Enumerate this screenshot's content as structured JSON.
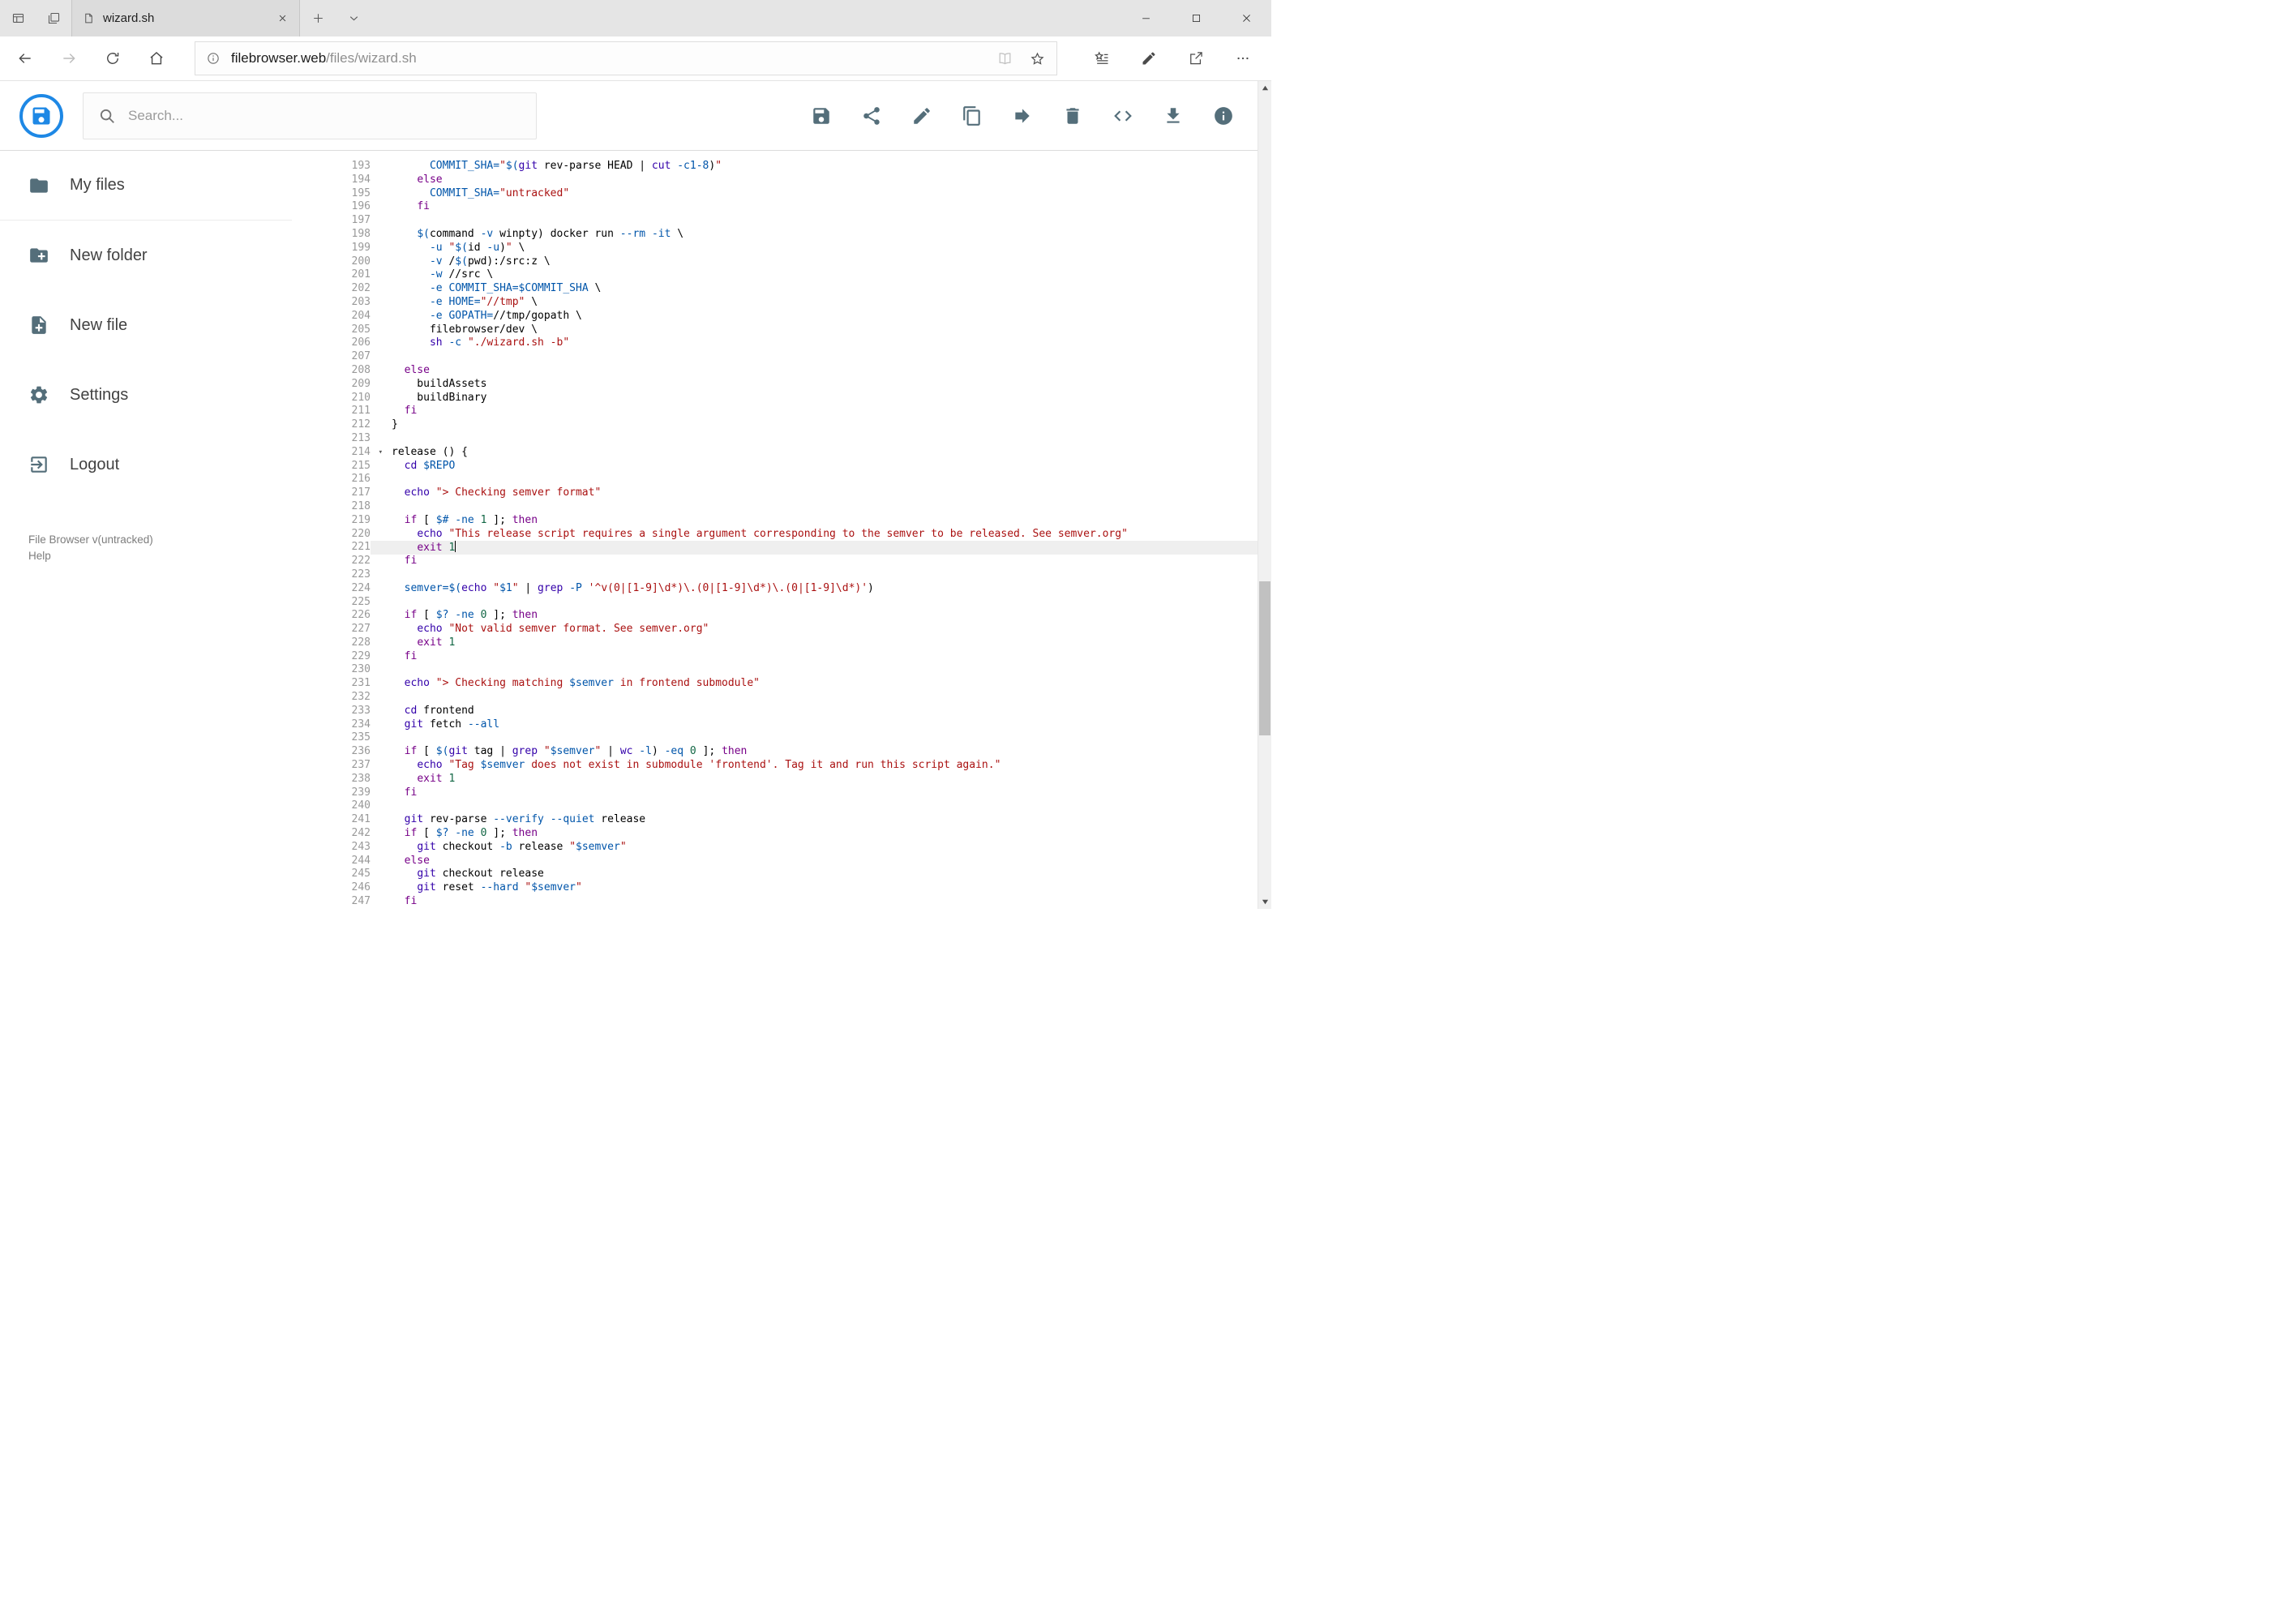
{
  "browser": {
    "tab_title": "wizard.sh",
    "url_host": "filebrowser.web",
    "url_path": "/files/wizard.sh",
    "tab_strip_buttons": [
      {
        "name": "tab-preview",
        "icon": "tab-preview"
      },
      {
        "name": "set-tabs-aside",
        "icon": "set-aside"
      }
    ],
    "window_controls": [
      {
        "name": "minimize",
        "icon": "minimize"
      },
      {
        "name": "maximize",
        "icon": "maximize"
      },
      {
        "name": "close-window",
        "icon": "close-window"
      }
    ],
    "nav_left": [
      {
        "name": "back",
        "icon": "back"
      },
      {
        "name": "forward",
        "icon": "forward",
        "disabled": true
      },
      {
        "name": "refresh",
        "icon": "refresh"
      },
      {
        "name": "home",
        "icon": "home"
      }
    ],
    "urlbar_right": [
      {
        "name": "reading-view",
        "icon": "reading-view",
        "disabled": true
      },
      {
        "name": "favorite-star",
        "icon": "favorite-star"
      }
    ],
    "nav_right": [
      {
        "name": "hub",
        "icon": "hub"
      },
      {
        "name": "web-note",
        "icon": "web-note"
      },
      {
        "name": "share",
        "icon": "share-arrow"
      },
      {
        "name": "more",
        "icon": "more"
      }
    ]
  },
  "app": {
    "search_placeholder": "Search...",
    "colors": {
      "logo_blue": "#1e88e5",
      "icon_gray": "#546e7a"
    },
    "toolbar": [
      {
        "name": "save",
        "icon": "save"
      },
      {
        "name": "share",
        "icon": "share-nodes"
      },
      {
        "name": "edit",
        "icon": "edit"
      },
      {
        "name": "copy",
        "icon": "copy"
      },
      {
        "name": "move",
        "icon": "move"
      },
      {
        "name": "delete",
        "icon": "delete"
      },
      {
        "name": "code",
        "icon": "code"
      },
      {
        "name": "download",
        "icon": "download"
      },
      {
        "name": "info",
        "icon": "info"
      }
    ],
    "sidebar": {
      "items": [
        {
          "id": "my-files",
          "label": "My files",
          "icon": "folder"
        },
        {
          "id": "new-folder",
          "label": "New folder",
          "icon": "new-folder"
        },
        {
          "id": "new-file",
          "label": "New file",
          "icon": "new-file"
        },
        {
          "id": "settings",
          "label": "Settings",
          "icon": "settings"
        },
        {
          "id": "logout",
          "label": "Logout",
          "icon": "logout"
        }
      ],
      "version": "File Browser v(untracked)",
      "help": "Help"
    }
  },
  "editor": {
    "language": "shell",
    "first_line": 193,
    "active_line": 221,
    "fold_marker_line": 214,
    "lines": [
      "      COMMIT_SHA=\"$(git rev-parse HEAD | cut -c1-8)\"",
      "    else",
      "      COMMIT_SHA=\"untracked\"",
      "    fi",
      "",
      "    $(command -v winpty) docker run --rm -it \\",
      "      -u \"$(id -u)\" \\",
      "      -v /$(pwd):/src:z \\",
      "      -w //src \\",
      "      -e COMMIT_SHA=$COMMIT_SHA \\",
      "      -e HOME=\"//tmp\" \\",
      "      -e GOPATH=//tmp/gopath \\",
      "      filebrowser/dev \\",
      "      sh -c \"./wizard.sh -b\"",
      "",
      "  else",
      "    buildAssets",
      "    buildBinary",
      "  fi",
      "}",
      "",
      "release () {",
      "  cd $REPO",
      "",
      "  echo \"> Checking semver format\"",
      "",
      "  if [ $# -ne 1 ]; then",
      "    echo \"This release script requires a single argument corresponding to the semver to be released. See semver.org\"",
      "    exit 1",
      "  fi",
      "",
      "  semver=$(echo \"$1\" | grep -P '^v(0|[1-9]\\d*)\\.(0|[1-9]\\d*)\\.(0|[1-9]\\d*)')",
      "",
      "  if [ $? -ne 0 ]; then",
      "    echo \"Not valid semver format. See semver.org\"",
      "    exit 1",
      "  fi",
      "",
      "  echo \"> Checking matching $semver in frontend submodule\"",
      "",
      "  cd frontend",
      "  git fetch --all",
      "",
      "  if [ $(git tag | grep \"$semver\" | wc -l) -eq 0 ]; then",
      "    echo \"Tag $semver does not exist in submodule 'frontend'. Tag it and run this script again.\"",
      "    exit 1",
      "  fi",
      "",
      "  git rev-parse --verify --quiet release",
      "  if [ $? -ne 0 ]; then",
      "    git checkout -b release \"$semver\"",
      "  else",
      "    git checkout release",
      "    git reset --hard \"$semver\"",
      "  fi"
    ]
  }
}
